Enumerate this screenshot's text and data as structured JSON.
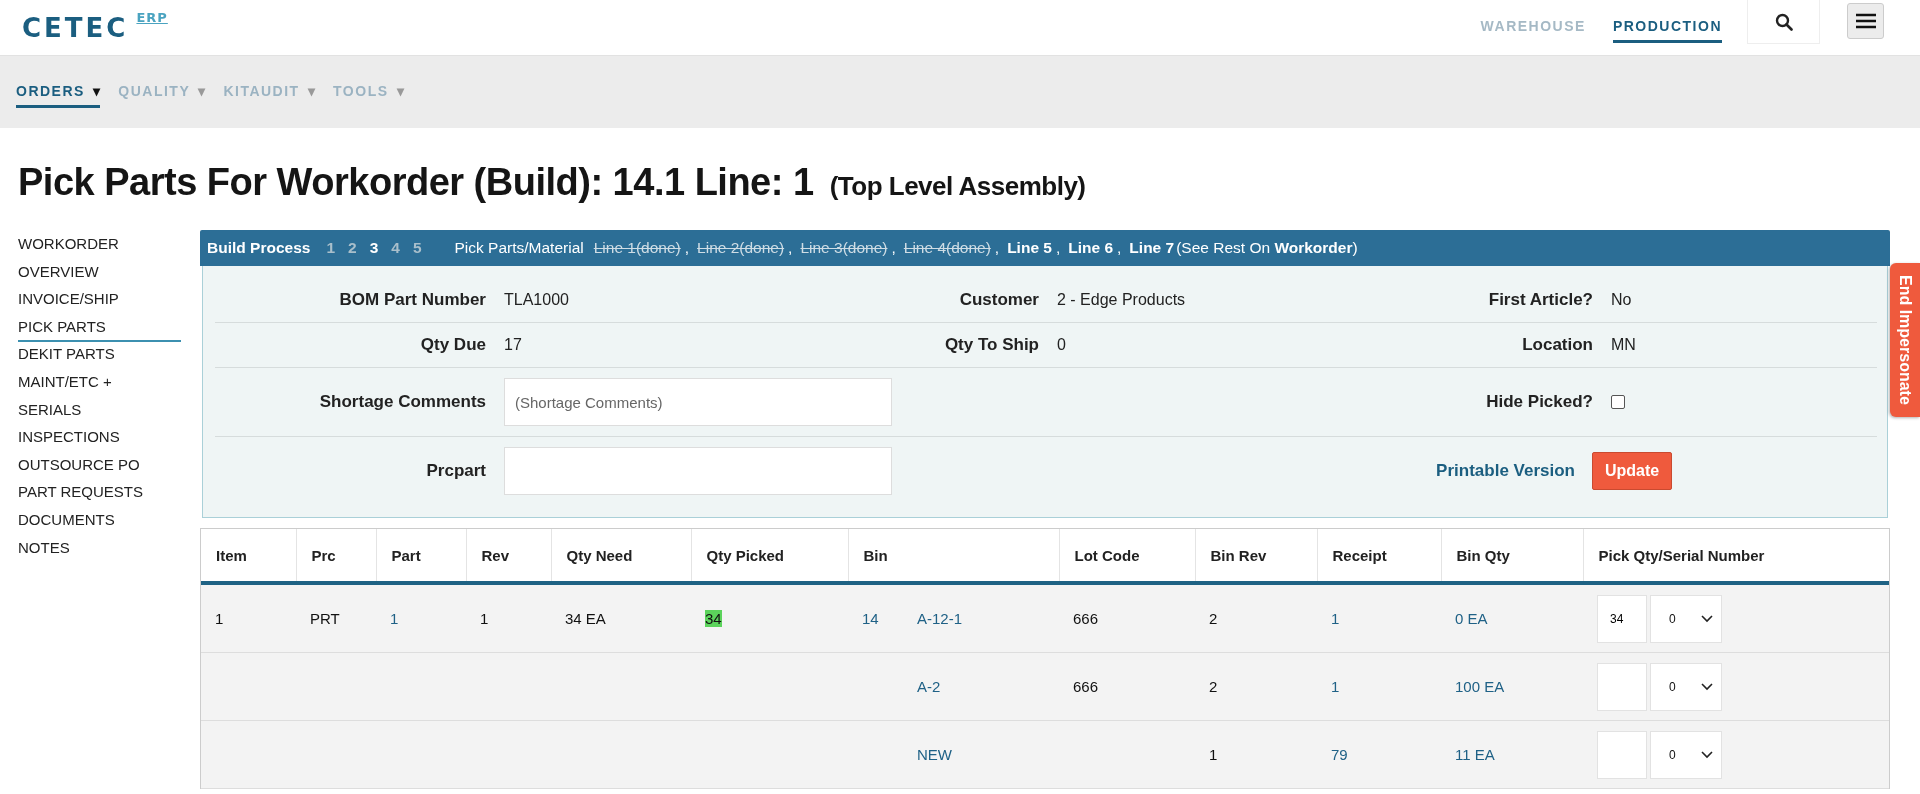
{
  "header": {
    "logo": "CETEC",
    "logo_suffix": "ERP",
    "nav": [
      {
        "label": "WAREHOUSE",
        "selected": false
      },
      {
        "label": "PRODUCTION",
        "selected": true
      }
    ]
  },
  "subnav": [
    {
      "label": "ORDERS",
      "caret": "▾",
      "selected": true
    },
    {
      "label": "QUALITY",
      "caret": "▾",
      "selected": false
    },
    {
      "label": "KITAUDIT",
      "caret": "▾",
      "selected": false
    },
    {
      "label": "TOOLS",
      "caret": "▾",
      "selected": false
    }
  ],
  "title": {
    "main": "Pick Parts For Workorder (Build): 14.1 Line: 1",
    "sub": "(Top Level Assembly)"
  },
  "sidebar": [
    {
      "label": "WORKORDER",
      "selected": false
    },
    {
      "label": "OVERVIEW",
      "selected": false
    },
    {
      "label": "INVOICE/SHIP",
      "selected": false
    },
    {
      "label": "PICK PARTS",
      "selected": true
    },
    {
      "label": "DEKIT PARTS",
      "selected": false
    },
    {
      "label": "MAINT/ETC +",
      "selected": false
    },
    {
      "label": "SERIALS",
      "selected": false
    },
    {
      "label": "INSPECTIONS",
      "selected": false
    },
    {
      "label": "OUTSOURCE PO",
      "selected": false
    },
    {
      "label": "PART REQUESTS",
      "selected": false
    },
    {
      "label": "DOCUMENTS",
      "selected": false
    },
    {
      "label": "NOTES",
      "selected": false
    }
  ],
  "build_bar": {
    "label": "Build Process",
    "steps": [
      {
        "label": "1",
        "selected": false
      },
      {
        "label": "2",
        "selected": false
      },
      {
        "label": "3",
        "selected": true
      },
      {
        "label": "4",
        "selected": false
      },
      {
        "label": "5",
        "selected": false
      }
    ],
    "pick_label": "Pick Parts/Material",
    "lines": [
      {
        "label": "Line 1(done)",
        "done": true,
        "separator": ","
      },
      {
        "label": "Line 2(done)",
        "done": true,
        "separator": ","
      },
      {
        "label": "Line 3(done)",
        "done": true,
        "separator": ","
      },
      {
        "label": "Line 4(done)",
        "done": true,
        "separator": ","
      },
      {
        "label": "Line 5",
        "done": false,
        "separator": ","
      },
      {
        "label": "Line 6",
        "done": false,
        "separator": ","
      },
      {
        "label": "Line 7",
        "done": false
      }
    ],
    "note": "(See Rest On **Workorder**)"
  },
  "details": {
    "rows": [
      [
        {
          "kind": "text",
          "label": "BOM Part Number",
          "value": "TLA1000"
        },
        {
          "kind": "text",
          "label": "Customer",
          "value": "2 - Edge Products"
        },
        {
          "kind": "text",
          "label": "First Article?",
          "value": "No"
        }
      ],
      [
        {
          "kind": "text",
          "label": "Qty Due",
          "value": "17"
        },
        {
          "kind": "text",
          "label": "Qty To Ship",
          "value": "0"
        },
        {
          "kind": "text",
          "label": "Location",
          "value": "MN"
        }
      ],
      [
        {
          "kind": "input",
          "label": "Shortage Comments",
          "placeholder": "(Shortage Comments)"
        },
        null,
        {
          "kind": "checkbox",
          "label": "Hide Picked?",
          "checked": false
        }
      ],
      [
        {
          "kind": "input",
          "label": "Prcpart"
        },
        null,
        {
          "kind": "actions",
          "link": "Printable Version",
          "button": "Update"
        }
      ]
    ]
  },
  "table": {
    "columns": [
      "Item",
      "Prc",
      "Part",
      "Rev",
      "Qty Need",
      "Qty Picked",
      "Bin",
      "Lot Code",
      "Bin Rev",
      "Receipt",
      "Bin Qty",
      "Pick Qty/Serial Number"
    ],
    "rows": [
      {
        "item": "1",
        "prc": "PRT",
        "part": "1",
        "rev": "1",
        "qty_need": "34 EA",
        "qty_picked": "34",
        "qty_picked_highlight": true,
        "bin_number": "14",
        "bin": "A-12-1",
        "lot_code": "666",
        "bin_rev": "2",
        "receipt": "1",
        "bin_qty": "0 EA",
        "pick_qty": "34",
        "serial": "0"
      },
      {
        "bin": "A-2",
        "lot_code": "666",
        "bin_rev": "2",
        "receipt": "1",
        "bin_qty": "100 EA",
        "serial": "0"
      },
      {
        "bin": "NEW",
        "bin_rev": "1",
        "receipt": "79",
        "bin_qty": "11 EA",
        "serial": "0"
      }
    ]
  },
  "impersonate": {
    "label": "End Impersonate"
  }
}
